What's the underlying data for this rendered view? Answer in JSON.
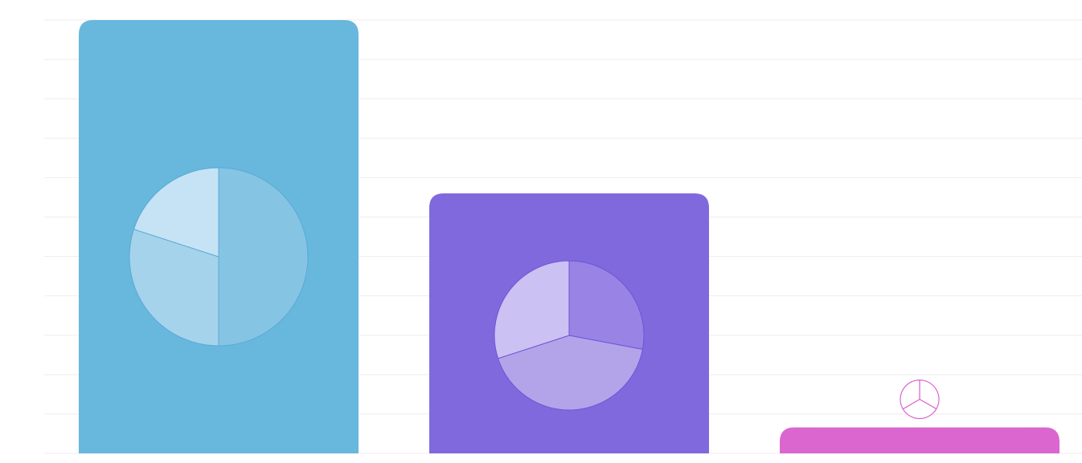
{
  "chart_data": {
    "type": "bar",
    "title": "",
    "xlabel": "",
    "ylabel": "",
    "grid": true,
    "ylim": [
      0,
      10
    ],
    "categories": [
      "",
      "",
      ""
    ],
    "values": [
      10,
      6,
      0.6
    ],
    "bar_colors": [
      "#68b7dd",
      "#8069dd",
      "#db66d0"
    ],
    "gridline_color": "#eeeeee",
    "inner_pies": [
      {
        "slices": [
          50,
          30,
          20
        ],
        "colors": [
          "#86c4e4",
          "#a5d3ec",
          "#c5e3f4"
        ],
        "stroke": "#5aaad6",
        "start_angle_deg": 0
      },
      {
        "slices": [
          28,
          42,
          30
        ],
        "colors": [
          "#9983e4",
          "#b3a4ea",
          "#cbc1f2"
        ],
        "stroke": "#6e55d6",
        "start_angle_deg": 0
      },
      {
        "slices": [
          33.3,
          33.3,
          33.4
        ],
        "colors": [
          "#ffffff",
          "#ffffff",
          "#ffffff"
        ],
        "stroke": "#db66d0",
        "start_angle_deg": 0,
        "outline_only": true
      }
    ]
  }
}
